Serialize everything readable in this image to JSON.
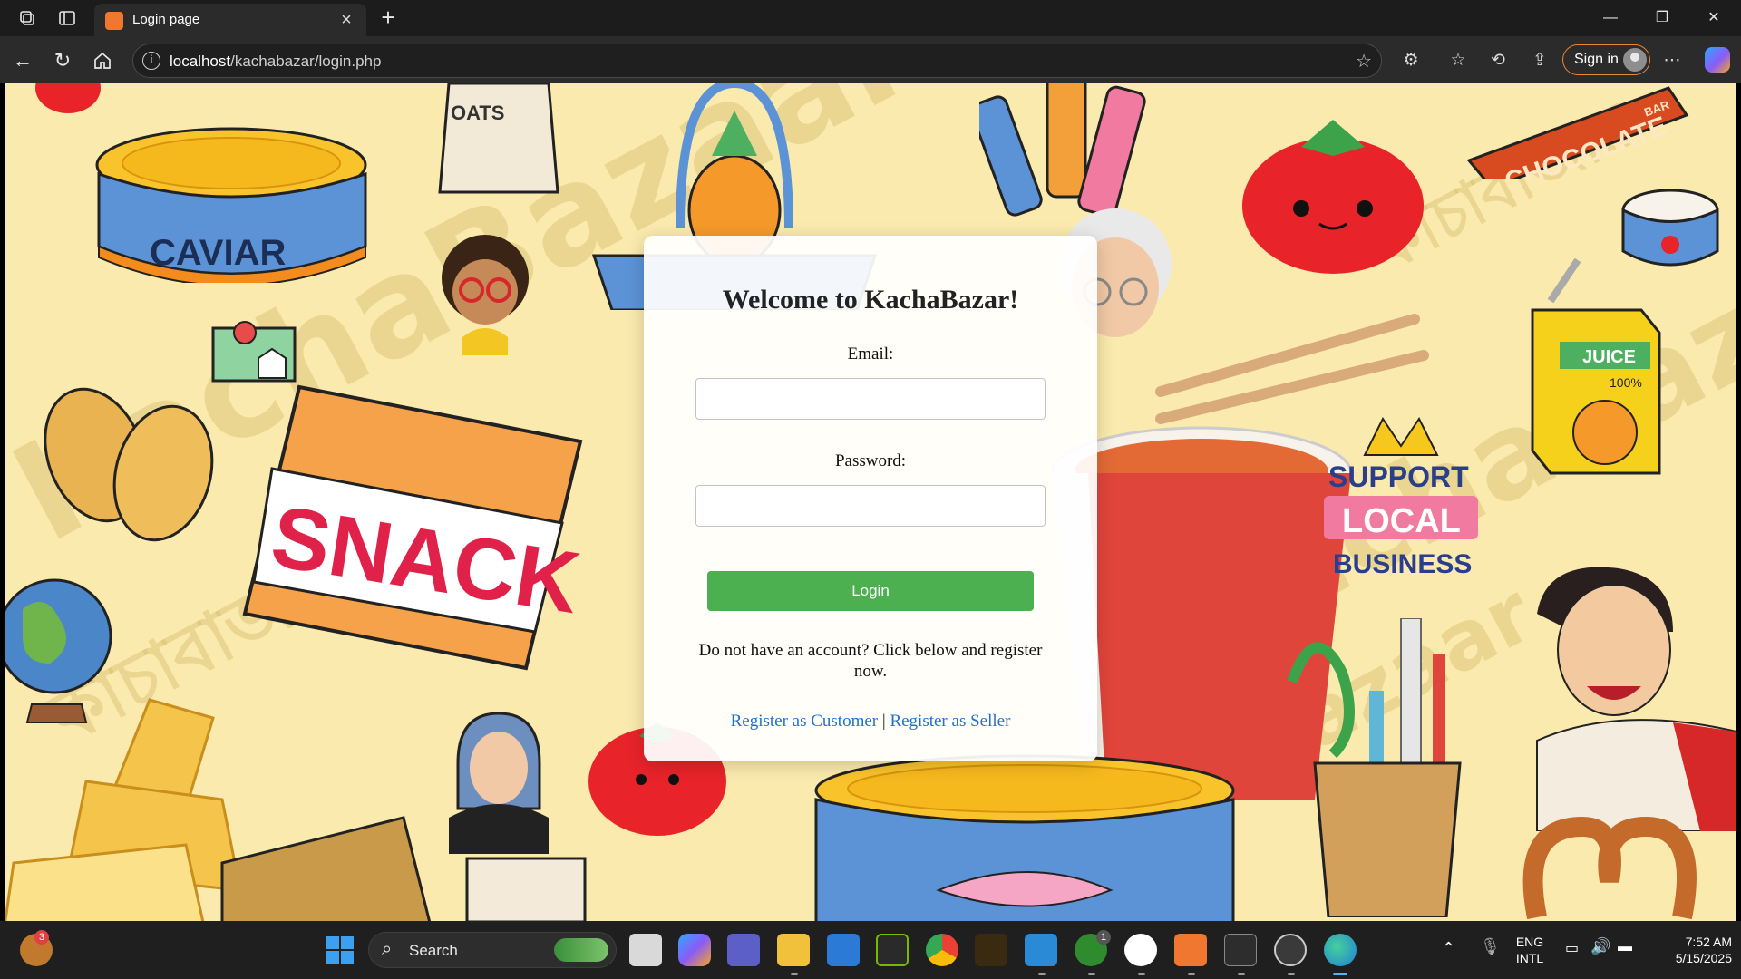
{
  "browser": {
    "tab_title": "Login page",
    "url_host": "localhost",
    "url_path": "/kachabazar/login.php",
    "signin_label": "Sign in"
  },
  "page": {
    "background_color": "#fbeaad",
    "watermark_brand": "KachaBazaar",
    "watermark_bangla": "কাঁচাবাজার",
    "stickers": {
      "caviar": "CAVIAR",
      "oats": "OATS",
      "snack": "SNACK",
      "chocolate": "CHOCOLATE",
      "chocolate_sub": "BAR",
      "juice": "JUICE",
      "juice_percent": "100%",
      "support_1": "SUPPORT",
      "support_2": "LOCAL",
      "support_3": "BUSINESS"
    },
    "form": {
      "title": "Welcome to KachaBazar!",
      "email_label": "Email:",
      "email_value": "",
      "password_label": "Password:",
      "password_value": "",
      "login_button": "Login",
      "register_prompt": "Do not have an account? Click below and register now.",
      "register_customer_link": "Register as Customer",
      "separator": "|",
      "register_seller_link": "Register as Seller",
      "button_color": "#4caf50",
      "link_color": "#1f6fd6"
    }
  },
  "taskbar": {
    "search_label": "Search",
    "widget_badge": "3",
    "xbox_badge": "1",
    "lang_line1": "ENG",
    "lang_line2": "INTL",
    "time": "7:52 AM",
    "date": "5/15/2025"
  }
}
